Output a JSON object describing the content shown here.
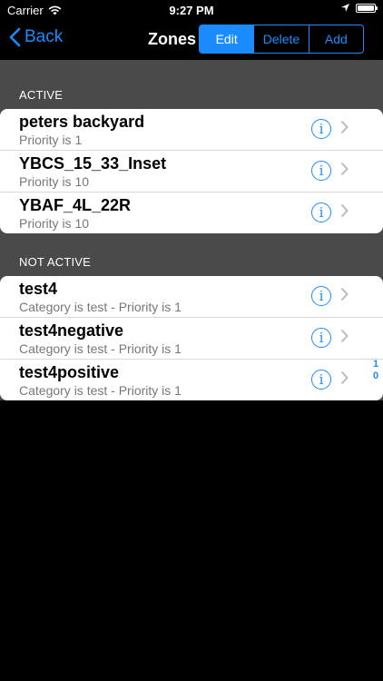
{
  "status": {
    "carrier": "Carrier",
    "time": "9:27 PM"
  },
  "nav": {
    "back_label": "Back",
    "title": "Zones",
    "segments": [
      "Edit",
      "Delete",
      "Add"
    ]
  },
  "sections": [
    {
      "header": "ACTIVE",
      "rows": [
        {
          "name": "peters backyard",
          "sub": "Priority is 1"
        },
        {
          "name": "YBCS_15_33_Inset",
          "sub": "Priority is 10"
        },
        {
          "name": "YBAF_4L_22R",
          "sub": "Priority is 10"
        }
      ]
    },
    {
      "header": "NOT ACTIVE",
      "rows": [
        {
          "name": "test4",
          "sub": "Category is test - Priority is 1"
        },
        {
          "name": "test4negative",
          "sub": "Category is test - Priority is 1"
        },
        {
          "name": "test4positive",
          "sub": "Category is test - Priority is 1"
        }
      ]
    }
  ],
  "index": [
    "1",
    "0"
  ],
  "accent": "#1a8cff"
}
